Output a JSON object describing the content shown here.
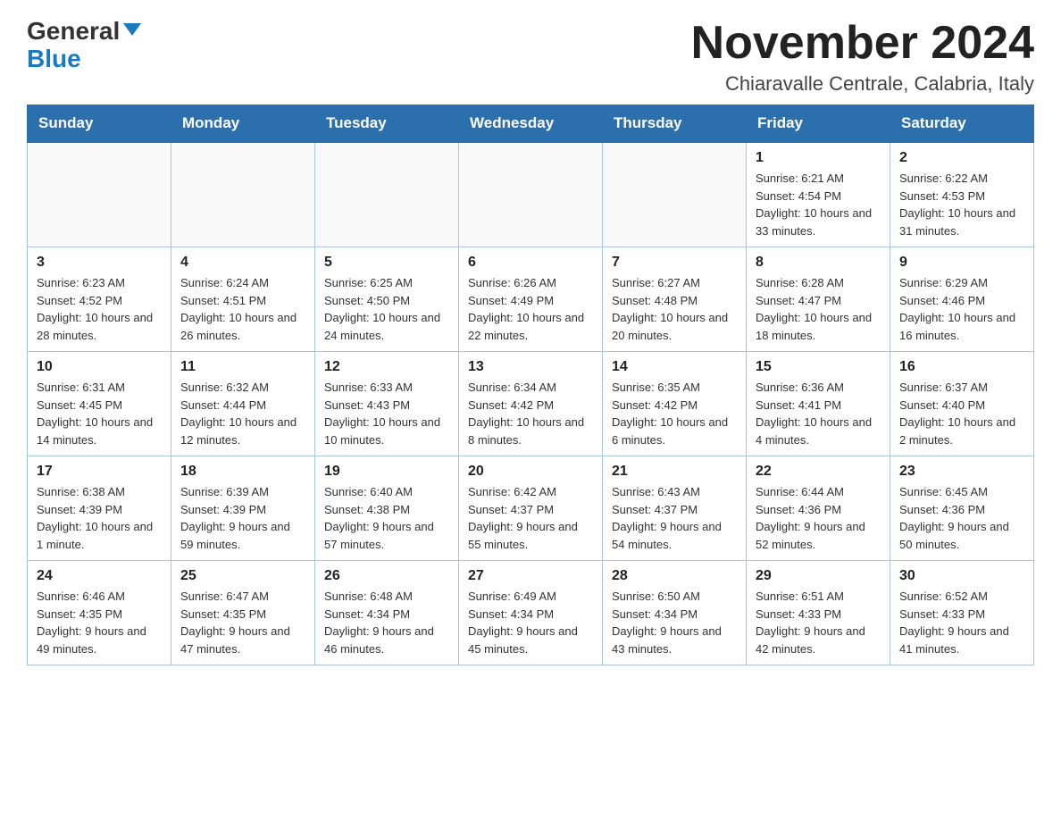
{
  "logo": {
    "general": "General",
    "blue": "Blue"
  },
  "header": {
    "month_year": "November 2024",
    "location": "Chiaravalle Centrale, Calabria, Italy"
  },
  "weekdays": [
    "Sunday",
    "Monday",
    "Tuesday",
    "Wednesday",
    "Thursday",
    "Friday",
    "Saturday"
  ],
  "weeks": [
    [
      {
        "day": "",
        "sunrise": "",
        "sunset": "",
        "daylight": ""
      },
      {
        "day": "",
        "sunrise": "",
        "sunset": "",
        "daylight": ""
      },
      {
        "day": "",
        "sunrise": "",
        "sunset": "",
        "daylight": ""
      },
      {
        "day": "",
        "sunrise": "",
        "sunset": "",
        "daylight": ""
      },
      {
        "day": "",
        "sunrise": "",
        "sunset": "",
        "daylight": ""
      },
      {
        "day": "1",
        "sunrise": "Sunrise: 6:21 AM",
        "sunset": "Sunset: 4:54 PM",
        "daylight": "Daylight: 10 hours and 33 minutes."
      },
      {
        "day": "2",
        "sunrise": "Sunrise: 6:22 AM",
        "sunset": "Sunset: 4:53 PM",
        "daylight": "Daylight: 10 hours and 31 minutes."
      }
    ],
    [
      {
        "day": "3",
        "sunrise": "Sunrise: 6:23 AM",
        "sunset": "Sunset: 4:52 PM",
        "daylight": "Daylight: 10 hours and 28 minutes."
      },
      {
        "day": "4",
        "sunrise": "Sunrise: 6:24 AM",
        "sunset": "Sunset: 4:51 PM",
        "daylight": "Daylight: 10 hours and 26 minutes."
      },
      {
        "day": "5",
        "sunrise": "Sunrise: 6:25 AM",
        "sunset": "Sunset: 4:50 PM",
        "daylight": "Daylight: 10 hours and 24 minutes."
      },
      {
        "day": "6",
        "sunrise": "Sunrise: 6:26 AM",
        "sunset": "Sunset: 4:49 PM",
        "daylight": "Daylight: 10 hours and 22 minutes."
      },
      {
        "day": "7",
        "sunrise": "Sunrise: 6:27 AM",
        "sunset": "Sunset: 4:48 PM",
        "daylight": "Daylight: 10 hours and 20 minutes."
      },
      {
        "day": "8",
        "sunrise": "Sunrise: 6:28 AM",
        "sunset": "Sunset: 4:47 PM",
        "daylight": "Daylight: 10 hours and 18 minutes."
      },
      {
        "day": "9",
        "sunrise": "Sunrise: 6:29 AM",
        "sunset": "Sunset: 4:46 PM",
        "daylight": "Daylight: 10 hours and 16 minutes."
      }
    ],
    [
      {
        "day": "10",
        "sunrise": "Sunrise: 6:31 AM",
        "sunset": "Sunset: 4:45 PM",
        "daylight": "Daylight: 10 hours and 14 minutes."
      },
      {
        "day": "11",
        "sunrise": "Sunrise: 6:32 AM",
        "sunset": "Sunset: 4:44 PM",
        "daylight": "Daylight: 10 hours and 12 minutes."
      },
      {
        "day": "12",
        "sunrise": "Sunrise: 6:33 AM",
        "sunset": "Sunset: 4:43 PM",
        "daylight": "Daylight: 10 hours and 10 minutes."
      },
      {
        "day": "13",
        "sunrise": "Sunrise: 6:34 AM",
        "sunset": "Sunset: 4:42 PM",
        "daylight": "Daylight: 10 hours and 8 minutes."
      },
      {
        "day": "14",
        "sunrise": "Sunrise: 6:35 AM",
        "sunset": "Sunset: 4:42 PM",
        "daylight": "Daylight: 10 hours and 6 minutes."
      },
      {
        "day": "15",
        "sunrise": "Sunrise: 6:36 AM",
        "sunset": "Sunset: 4:41 PM",
        "daylight": "Daylight: 10 hours and 4 minutes."
      },
      {
        "day": "16",
        "sunrise": "Sunrise: 6:37 AM",
        "sunset": "Sunset: 4:40 PM",
        "daylight": "Daylight: 10 hours and 2 minutes."
      }
    ],
    [
      {
        "day": "17",
        "sunrise": "Sunrise: 6:38 AM",
        "sunset": "Sunset: 4:39 PM",
        "daylight": "Daylight: 10 hours and 1 minute."
      },
      {
        "day": "18",
        "sunrise": "Sunrise: 6:39 AM",
        "sunset": "Sunset: 4:39 PM",
        "daylight": "Daylight: 9 hours and 59 minutes."
      },
      {
        "day": "19",
        "sunrise": "Sunrise: 6:40 AM",
        "sunset": "Sunset: 4:38 PM",
        "daylight": "Daylight: 9 hours and 57 minutes."
      },
      {
        "day": "20",
        "sunrise": "Sunrise: 6:42 AM",
        "sunset": "Sunset: 4:37 PM",
        "daylight": "Daylight: 9 hours and 55 minutes."
      },
      {
        "day": "21",
        "sunrise": "Sunrise: 6:43 AM",
        "sunset": "Sunset: 4:37 PM",
        "daylight": "Daylight: 9 hours and 54 minutes."
      },
      {
        "day": "22",
        "sunrise": "Sunrise: 6:44 AM",
        "sunset": "Sunset: 4:36 PM",
        "daylight": "Daylight: 9 hours and 52 minutes."
      },
      {
        "day": "23",
        "sunrise": "Sunrise: 6:45 AM",
        "sunset": "Sunset: 4:36 PM",
        "daylight": "Daylight: 9 hours and 50 minutes."
      }
    ],
    [
      {
        "day": "24",
        "sunrise": "Sunrise: 6:46 AM",
        "sunset": "Sunset: 4:35 PM",
        "daylight": "Daylight: 9 hours and 49 minutes."
      },
      {
        "day": "25",
        "sunrise": "Sunrise: 6:47 AM",
        "sunset": "Sunset: 4:35 PM",
        "daylight": "Daylight: 9 hours and 47 minutes."
      },
      {
        "day": "26",
        "sunrise": "Sunrise: 6:48 AM",
        "sunset": "Sunset: 4:34 PM",
        "daylight": "Daylight: 9 hours and 46 minutes."
      },
      {
        "day": "27",
        "sunrise": "Sunrise: 6:49 AM",
        "sunset": "Sunset: 4:34 PM",
        "daylight": "Daylight: 9 hours and 45 minutes."
      },
      {
        "day": "28",
        "sunrise": "Sunrise: 6:50 AM",
        "sunset": "Sunset: 4:34 PM",
        "daylight": "Daylight: 9 hours and 43 minutes."
      },
      {
        "day": "29",
        "sunrise": "Sunrise: 6:51 AM",
        "sunset": "Sunset: 4:33 PM",
        "daylight": "Daylight: 9 hours and 42 minutes."
      },
      {
        "day": "30",
        "sunrise": "Sunrise: 6:52 AM",
        "sunset": "Sunset: 4:33 PM",
        "daylight": "Daylight: 9 hours and 41 minutes."
      }
    ]
  ]
}
